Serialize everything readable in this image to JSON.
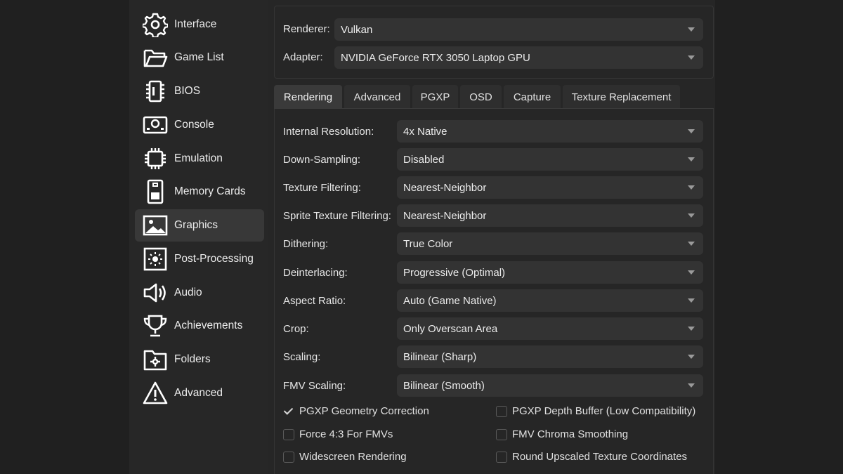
{
  "sidebar": {
    "items": [
      {
        "label": "Interface",
        "icon": "gear-icon"
      },
      {
        "label": "Game List",
        "icon": "folder-open-icon"
      },
      {
        "label": "BIOS",
        "icon": "chip-icon"
      },
      {
        "label": "Console",
        "icon": "console-icon"
      },
      {
        "label": "Emulation",
        "icon": "cpu-icon"
      },
      {
        "label": "Memory Cards",
        "icon": "memory-card-icon"
      },
      {
        "label": "Graphics",
        "icon": "image-icon"
      },
      {
        "label": "Post-Processing",
        "icon": "brightness-icon"
      },
      {
        "label": "Audio",
        "icon": "speaker-icon"
      },
      {
        "label": "Achievements",
        "icon": "trophy-icon"
      },
      {
        "label": "Folders",
        "icon": "folder-settings-icon"
      },
      {
        "label": "Advanced",
        "icon": "warning-icon"
      }
    ],
    "active": "Graphics"
  },
  "device": {
    "renderer_label": "Renderer:",
    "renderer_value": "Vulkan",
    "adapter_label": "Adapter:",
    "adapter_value": "NVIDIA GeForce RTX 3050 Laptop GPU"
  },
  "tabs": [
    {
      "label": "Rendering",
      "active": true
    },
    {
      "label": "Advanced",
      "active": false
    },
    {
      "label": "PGXP",
      "active": false
    },
    {
      "label": "OSD",
      "active": false
    },
    {
      "label": "Capture",
      "active": false
    },
    {
      "label": "Texture Replacement",
      "active": false
    }
  ],
  "settings": [
    {
      "label": "Internal Resolution:",
      "value": "4x Native"
    },
    {
      "label": "Down-Sampling:",
      "value": "Disabled"
    },
    {
      "label": "Texture Filtering:",
      "value": "Nearest-Neighbor"
    },
    {
      "label": "Sprite Texture Filtering:",
      "value": "Nearest-Neighbor"
    },
    {
      "label": "Dithering:",
      "value": "True Color"
    },
    {
      "label": "Deinterlacing:",
      "value": "Progressive (Optimal)"
    },
    {
      "label": "Aspect Ratio:",
      "value": "Auto (Game Native)"
    },
    {
      "label": "Crop:",
      "value": "Only Overscan Area"
    },
    {
      "label": "Scaling:",
      "value": "Bilinear (Sharp)"
    },
    {
      "label": "FMV Scaling:",
      "value": "Bilinear (Smooth)"
    }
  ],
  "checkboxes": [
    {
      "label": "PGXP Geometry Correction",
      "checked": true
    },
    {
      "label": "PGXP Depth Buffer (Low Compatibility)",
      "checked": false
    },
    {
      "label": "Force 4:3 For FMVs",
      "checked": false
    },
    {
      "label": "FMV Chroma Smoothing",
      "checked": false
    },
    {
      "label": "Widescreen Rendering",
      "checked": false
    },
    {
      "label": "Round Upscaled Texture Coordinates",
      "checked": false
    }
  ],
  "colors": {
    "background": "#262626",
    "sidebar_active": "#383838",
    "combo_bg": "#333333",
    "text": "#e6e6e6"
  }
}
